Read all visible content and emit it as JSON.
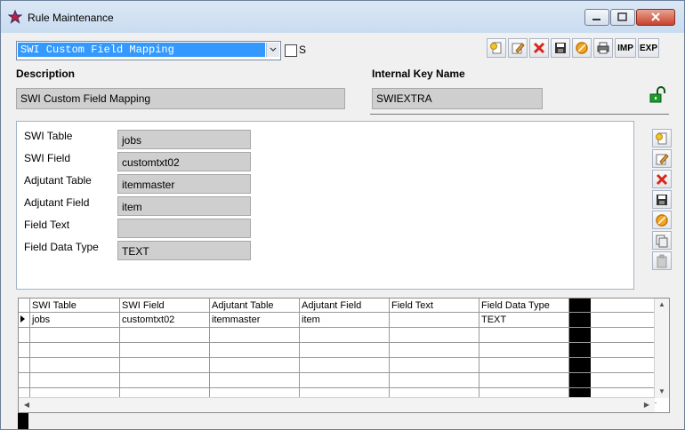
{
  "window": {
    "title": "Rule Maintenance"
  },
  "toolbar": {
    "rule_select_value": "SWI Custom Field Mapping",
    "checkbox_label": "S",
    "imp_label": "IMP",
    "exp_label": "EXP"
  },
  "header": {
    "description_label": "Description",
    "description_value": "SWI Custom Field Mapping",
    "internal_key_label": "Internal Key Name",
    "internal_key_value": "SWIEXTRA"
  },
  "detail": {
    "fields": [
      {
        "label": "SWI Table",
        "value": "jobs"
      },
      {
        "label": "SWI Field",
        "value": "customtxt02"
      },
      {
        "label": "Adjutant Table",
        "value": "itemmaster"
      },
      {
        "label": "Adjutant Field",
        "value": "item"
      },
      {
        "label": "Field Text",
        "value": ""
      },
      {
        "label": "Field Data Type",
        "value": "TEXT"
      }
    ]
  },
  "grid": {
    "columns": [
      "SWI Table",
      "SWI Field",
      "Adjutant Table",
      "Adjutant Field",
      "Field Text",
      "Field Data Type"
    ],
    "rows": [
      [
        "jobs",
        "customtxt02",
        "itemmaster",
        "item",
        "",
        "TEXT"
      ]
    ]
  },
  "colors": {
    "selection": "#3399ff",
    "field_bg": "#cfcfcf",
    "close_button": "#c7432b",
    "lock_green": "#1c9a2a"
  }
}
